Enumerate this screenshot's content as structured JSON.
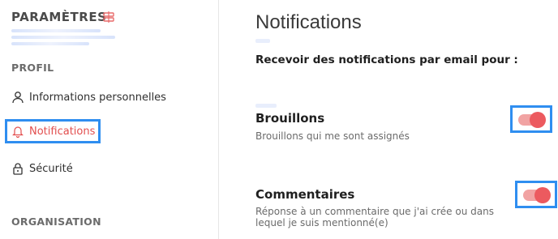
{
  "sidebar": {
    "title": "PARAMÈTRES",
    "sections": {
      "profile": "PROFIL",
      "organisation": "ORGANISATION"
    },
    "items": [
      {
        "label": "Informations personnelles",
        "icon": "user-icon"
      },
      {
        "label": "Notifications",
        "icon": "bell-icon",
        "active": true
      },
      {
        "label": "Sécurité",
        "icon": "lock-icon"
      }
    ]
  },
  "main": {
    "title": "Notifications",
    "lead": "Recevoir des notifications par email pour :",
    "groups": [
      {
        "title": "Brouillons",
        "description": "Brouillons qui me sont assignés",
        "enabled": true
      },
      {
        "title": "Commentaires",
        "description": "Réponse à un commentaire que j'ai crée ou dans lequel je suis mentionné(e)",
        "enabled": true
      }
    ]
  },
  "colors": {
    "accent": "#e24e4e",
    "toggle_on_track": "#f1a3a3",
    "toggle_on_knob": "#ec5a5f",
    "highlight": "#2f8ef0"
  }
}
